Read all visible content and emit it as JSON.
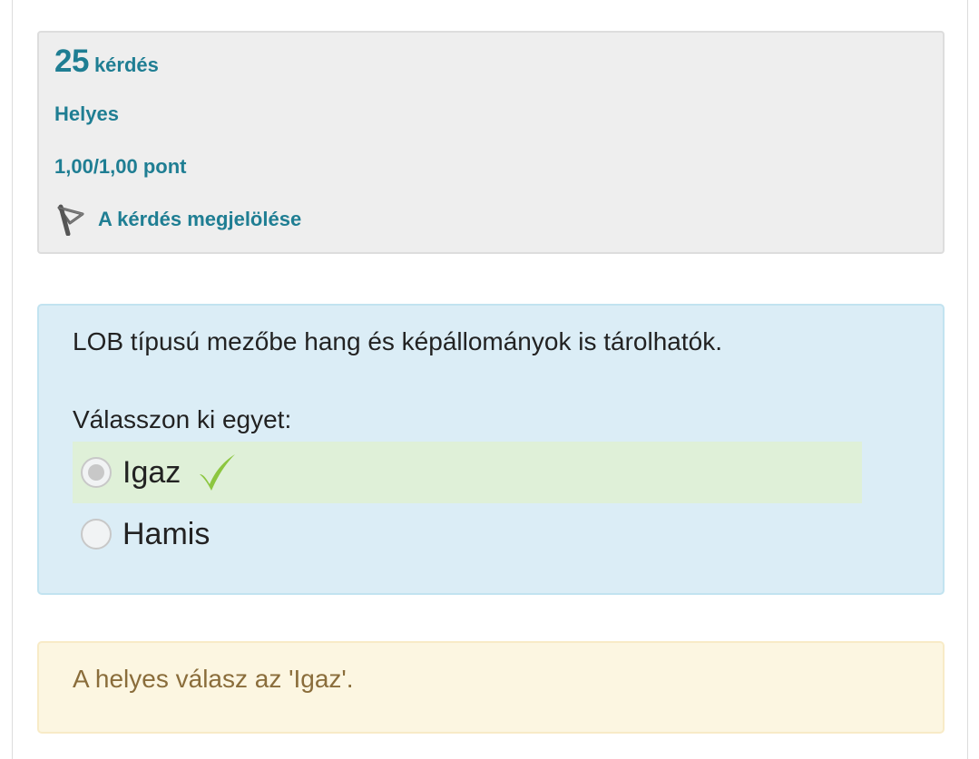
{
  "info": {
    "question_number": "25",
    "question_word": "kérdés",
    "state": "Helyes",
    "grade": "1,00/1,00 pont",
    "flag_label": "A kérdés megjelölése"
  },
  "question": {
    "text": "LOB típusú mezőbe hang és képállományok is tárolhatók.",
    "prompt": "Válasszon ki egyet:",
    "answers": [
      {
        "label": "Igaz",
        "selected": true,
        "correct": true
      },
      {
        "label": "Hamis",
        "selected": false,
        "correct": false
      }
    ]
  },
  "feedback": {
    "text": "A helyes válasz az 'Igaz'."
  },
  "colors": {
    "accent": "#1f7e93",
    "question_bg": "#dbedf6",
    "correct_bg": "#dff0d8",
    "check": "#8cc63f",
    "feedback_bg": "#fcf6e1",
    "feedback_text": "#8a6d3b"
  }
}
